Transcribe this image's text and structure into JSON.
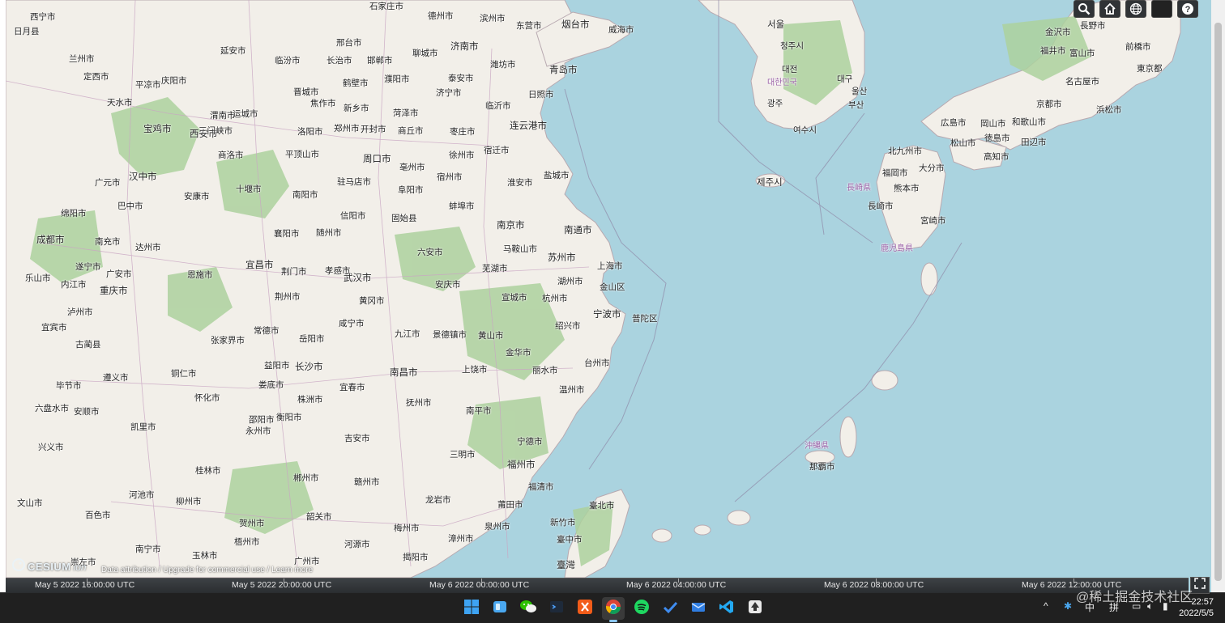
{
  "toolbar": {
    "search_icon": "search-icon",
    "home_icon": "home-icon",
    "scene_icon": "globe-icon",
    "layer_icon": "imagery-icon",
    "help_icon": "help-icon"
  },
  "map": {
    "labels": [
      {
        "t": "西宁市"
      },
      {
        "t": "日月县"
      },
      {
        "t": "兰州市"
      },
      {
        "t": "定西市"
      },
      {
        "t": "天水市"
      },
      {
        "t": "宝鸡市"
      },
      {
        "t": "西安市"
      },
      {
        "t": "渭南市"
      },
      {
        "t": "延安市"
      },
      {
        "t": "庆阳市"
      },
      {
        "t": "平凉市"
      },
      {
        "t": "商洛市"
      },
      {
        "t": "汉中市"
      },
      {
        "t": "安康市"
      },
      {
        "t": "广元市"
      },
      {
        "t": "巴中市"
      },
      {
        "t": "绵阳市"
      },
      {
        "t": "成都市"
      },
      {
        "t": "南充市"
      },
      {
        "t": "达州市"
      },
      {
        "t": "遂宁市"
      },
      {
        "t": "广安市"
      },
      {
        "t": "内江市"
      },
      {
        "t": "乐山市"
      },
      {
        "t": "重庆市"
      },
      {
        "t": "泸州市"
      },
      {
        "t": "宜宾市"
      },
      {
        "t": "古蔺县"
      },
      {
        "t": "遵义市"
      },
      {
        "t": "毕节市"
      },
      {
        "t": "六盘水市"
      },
      {
        "t": "安顺市"
      },
      {
        "t": "凯里市"
      },
      {
        "t": "兴义市"
      },
      {
        "t": "铜仁市"
      },
      {
        "t": "怀化市"
      },
      {
        "t": "邵阳市"
      },
      {
        "t": "永州市"
      },
      {
        "t": "桂林市"
      },
      {
        "t": "柳州市"
      },
      {
        "t": "河池市"
      },
      {
        "t": "百色市"
      },
      {
        "t": "南宁市"
      },
      {
        "t": "贺州市"
      },
      {
        "t": "梧州市"
      },
      {
        "t": "玉林市"
      },
      {
        "t": "崇左市"
      },
      {
        "t": "文山市"
      },
      {
        "t": "石家庄市"
      },
      {
        "t": "德州市"
      },
      {
        "t": "滨州市"
      },
      {
        "t": "东营市"
      },
      {
        "t": "烟台市"
      },
      {
        "t": "威海市"
      },
      {
        "t": "邢台市"
      },
      {
        "t": "济南市"
      },
      {
        "t": "潍坊市"
      },
      {
        "t": "青岛市"
      },
      {
        "t": "聊城市"
      },
      {
        "t": "临汾市"
      },
      {
        "t": "长治市"
      },
      {
        "t": "邯郸市"
      },
      {
        "t": "晋城市"
      },
      {
        "t": "鹤壁市"
      },
      {
        "t": "濮阳市"
      },
      {
        "t": "泰安市"
      },
      {
        "t": "临沂市"
      },
      {
        "t": "日照市"
      },
      {
        "t": "焦作市"
      },
      {
        "t": "新乡市"
      },
      {
        "t": "济宁市"
      },
      {
        "t": "运城市"
      },
      {
        "t": "洛阳市"
      },
      {
        "t": "郑州市"
      },
      {
        "t": "开封市"
      },
      {
        "t": "菏泽市"
      },
      {
        "t": "商丘市"
      },
      {
        "t": "枣庄市"
      },
      {
        "t": "连云港市"
      },
      {
        "t": "三门峡市"
      },
      {
        "t": "平顶山市"
      },
      {
        "t": "周口市"
      },
      {
        "t": "亳州市"
      },
      {
        "t": "宿迁市"
      },
      {
        "t": "徐州市"
      },
      {
        "t": "盐城市"
      },
      {
        "t": "淮安市"
      },
      {
        "t": "宿州市"
      },
      {
        "t": "十堰市"
      },
      {
        "t": "南阳市"
      },
      {
        "t": "驻马店市"
      },
      {
        "t": "阜阳市"
      },
      {
        "t": "蚌埠市"
      },
      {
        "t": "信阳市"
      },
      {
        "t": "固始县"
      },
      {
        "t": "南京市"
      },
      {
        "t": "南通市"
      },
      {
        "t": "襄阳市"
      },
      {
        "t": "随州市"
      },
      {
        "t": "六安市"
      },
      {
        "t": "马鞍山市"
      },
      {
        "t": "苏州市"
      },
      {
        "t": "上海市"
      },
      {
        "t": "宜昌市"
      },
      {
        "t": "荆门市"
      },
      {
        "t": "孝感市"
      },
      {
        "t": "芜湖市"
      },
      {
        "t": "湖州市"
      },
      {
        "t": "金山区"
      },
      {
        "t": "恩施市"
      },
      {
        "t": "荆州市"
      },
      {
        "t": "武汉市"
      },
      {
        "t": "安庆市"
      },
      {
        "t": "宣城市"
      },
      {
        "t": "杭州市"
      },
      {
        "t": "黄冈市"
      },
      {
        "t": "宁波市"
      },
      {
        "t": "普陀区"
      },
      {
        "t": "常德市"
      },
      {
        "t": "岳阳市"
      },
      {
        "t": "咸宁市"
      },
      {
        "t": "九江市"
      },
      {
        "t": "景德镇市"
      },
      {
        "t": "黄山市"
      },
      {
        "t": "绍兴市"
      },
      {
        "t": "张家界市"
      },
      {
        "t": "金华市"
      },
      {
        "t": "台州市"
      },
      {
        "t": "益阳市"
      },
      {
        "t": "长沙市"
      },
      {
        "t": "南昌市"
      },
      {
        "t": "上饶市"
      },
      {
        "t": "丽水市"
      },
      {
        "t": "娄底市"
      },
      {
        "t": "宜春市"
      },
      {
        "t": "温州市"
      },
      {
        "t": "株洲市"
      },
      {
        "t": "抚州市"
      },
      {
        "t": "衡阳市"
      },
      {
        "t": "南平市"
      },
      {
        "t": "宁德市"
      },
      {
        "t": "吉安市"
      },
      {
        "t": "三明市"
      },
      {
        "t": "福州市"
      },
      {
        "t": "郴州市"
      },
      {
        "t": "赣州市"
      },
      {
        "t": "福清市"
      },
      {
        "t": "龙岩市"
      },
      {
        "t": "莆田市"
      },
      {
        "t": "韶关市"
      },
      {
        "t": "泉州市"
      },
      {
        "t": "梅州市"
      },
      {
        "t": "漳州市"
      },
      {
        "t": "河源市"
      },
      {
        "t": "揭阳市"
      },
      {
        "t": "广州市"
      },
      {
        "t": "新竹市"
      },
      {
        "t": "臺中市"
      },
      {
        "t": "臺北市"
      },
      {
        "t": "臺灣"
      },
      {
        "t": "서울"
      },
      {
        "t": "청주시"
      },
      {
        "t": "대전"
      },
      {
        "t": "대구"
      },
      {
        "t": "광주"
      },
      {
        "t": "부산"
      },
      {
        "t": "울산"
      },
      {
        "t": "여수시"
      },
      {
        "t": "대한민국"
      },
      {
        "t": "제주시"
      },
      {
        "t": "福岡市"
      },
      {
        "t": "北九州市"
      },
      {
        "t": "広島市"
      },
      {
        "t": "岡山市"
      },
      {
        "t": "大分市"
      },
      {
        "t": "松山市"
      },
      {
        "t": "徳島市"
      },
      {
        "t": "高知市"
      },
      {
        "t": "熊本市"
      },
      {
        "t": "長崎市"
      },
      {
        "t": "宮崎市"
      },
      {
        "t": "鹿児島県"
      },
      {
        "t": "沖縄県"
      },
      {
        "t": "那覇市"
      },
      {
        "t": "京都市"
      },
      {
        "t": "和歌山市"
      },
      {
        "t": "名古屋市"
      },
      {
        "t": "浜松市"
      },
      {
        "t": "東京都"
      },
      {
        "t": "前橋市"
      },
      {
        "t": "長野市"
      },
      {
        "t": "福井市"
      },
      {
        "t": "金沢市"
      },
      {
        "t": "富山市"
      },
      {
        "t": "田辺市"
      },
      {
        "t": "長崎県"
      }
    ]
  },
  "credits": {
    "logo_word": "CESIUM",
    "logo_ion": "ion",
    "text": "Data attribution / Upgrade for commercial use / Learn more"
  },
  "timeline": {
    "ticks": [
      "May 5 2022 16:00:00 UTC",
      "May 5 2022 20:00:00 UTC",
      "May 6 2022 00:00:00 UTC",
      "May 6 2022 04:00:00 UTC",
      "May 6 2022 08:00:00 UTC",
      "May 6 2022 12:00:00 UTC"
    ]
  },
  "taskbar": {
    "apps": [
      "windows-start",
      "widgets",
      "wechat",
      "terminal",
      "xmind",
      "chrome",
      "spotify",
      "todo",
      "mail",
      "vscode",
      "inkscape"
    ],
    "tray_ime_1": "中",
    "tray_ime_2": "拼",
    "time": "22:57",
    "date": "2022/5/5",
    "watermark": "@稀土掘金技术社区"
  },
  "colors": {
    "sea": "#aad3df",
    "land": "#f2efe9",
    "forest": "#add19e",
    "timeline": "#303336",
    "taskbar": "#202020"
  }
}
